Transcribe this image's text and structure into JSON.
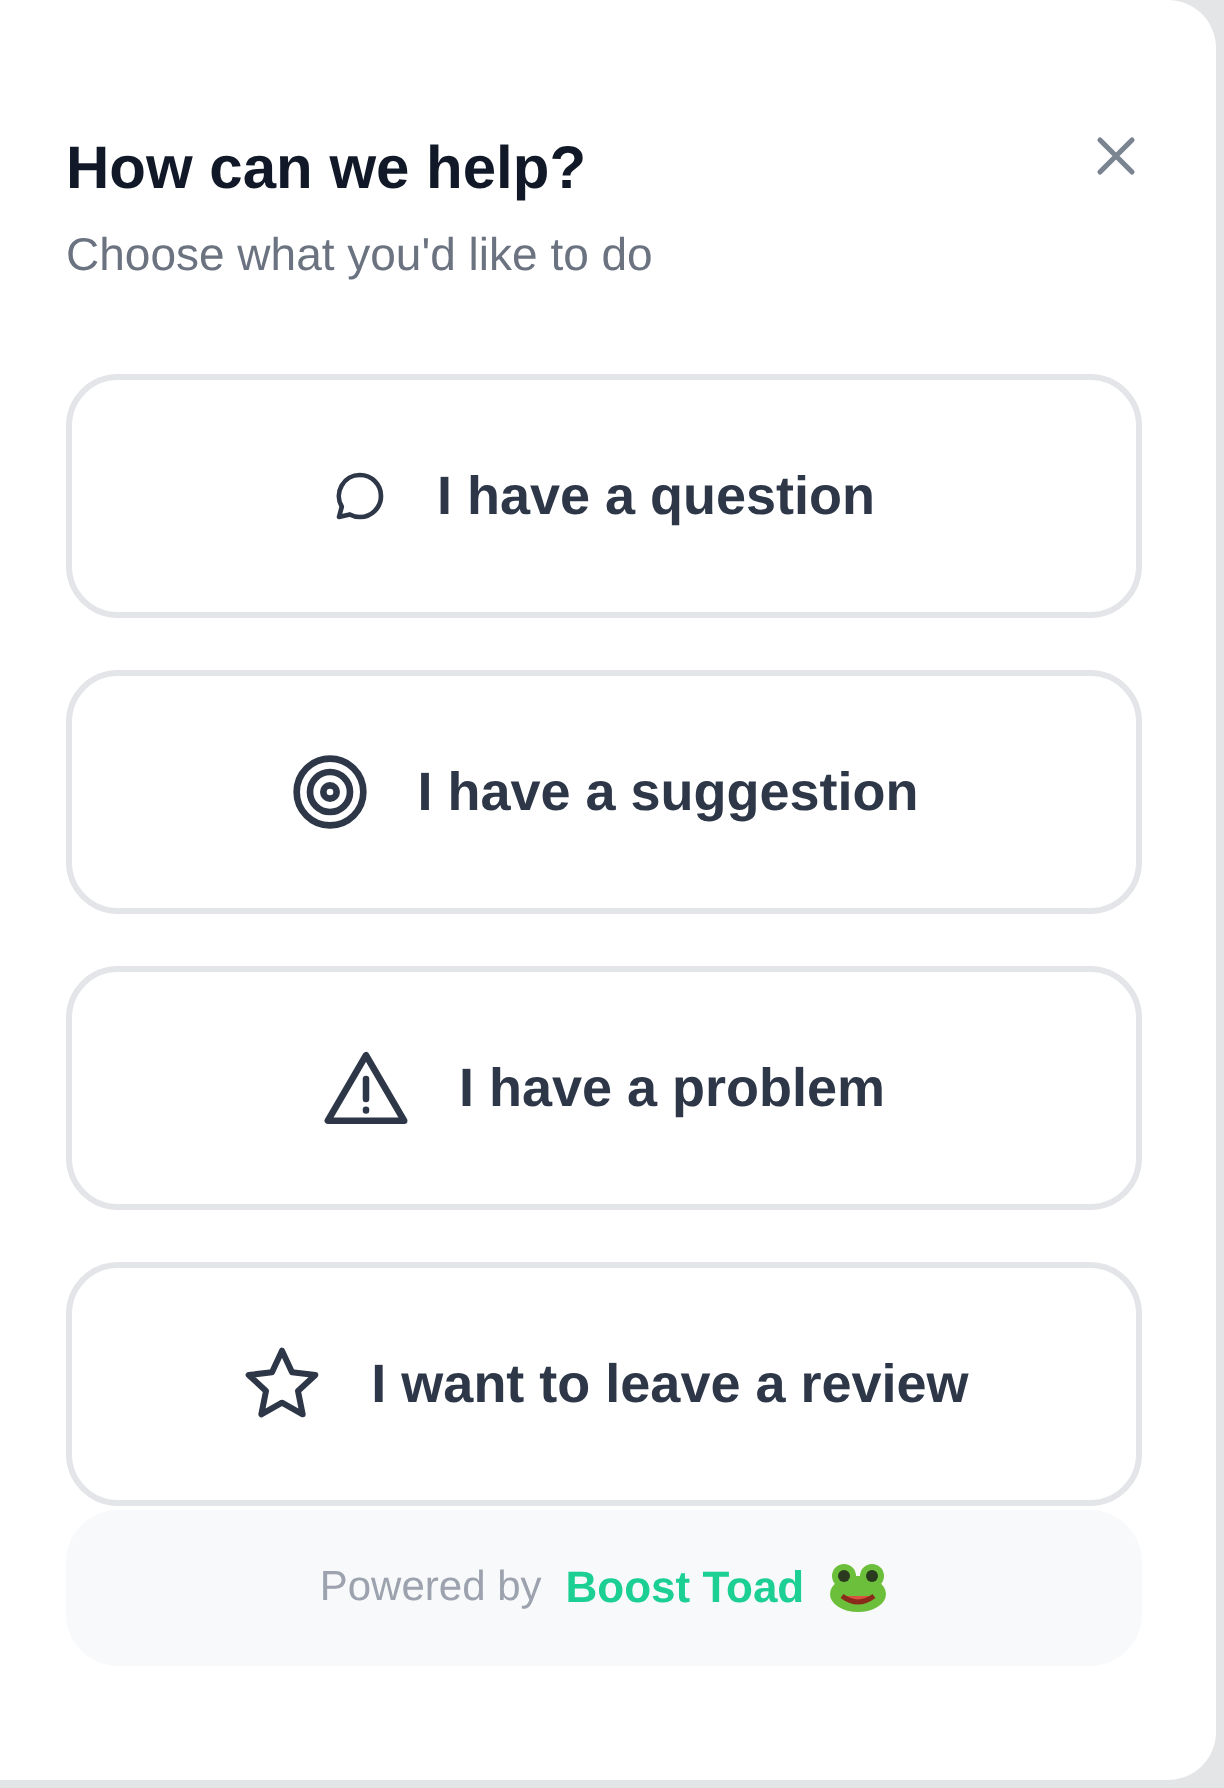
{
  "dialog": {
    "title": "How can we help?",
    "subtitle": "Choose what you'd like to do"
  },
  "options": [
    {
      "kind": "question",
      "label": "I have a question"
    },
    {
      "kind": "suggestion",
      "label": "I have a suggestion"
    },
    {
      "kind": "problem",
      "label": "I have a problem"
    },
    {
      "kind": "review",
      "label": "I want to leave a review"
    }
  ],
  "footer": {
    "prefix": "Powered by",
    "brand": "Boost Toad"
  }
}
